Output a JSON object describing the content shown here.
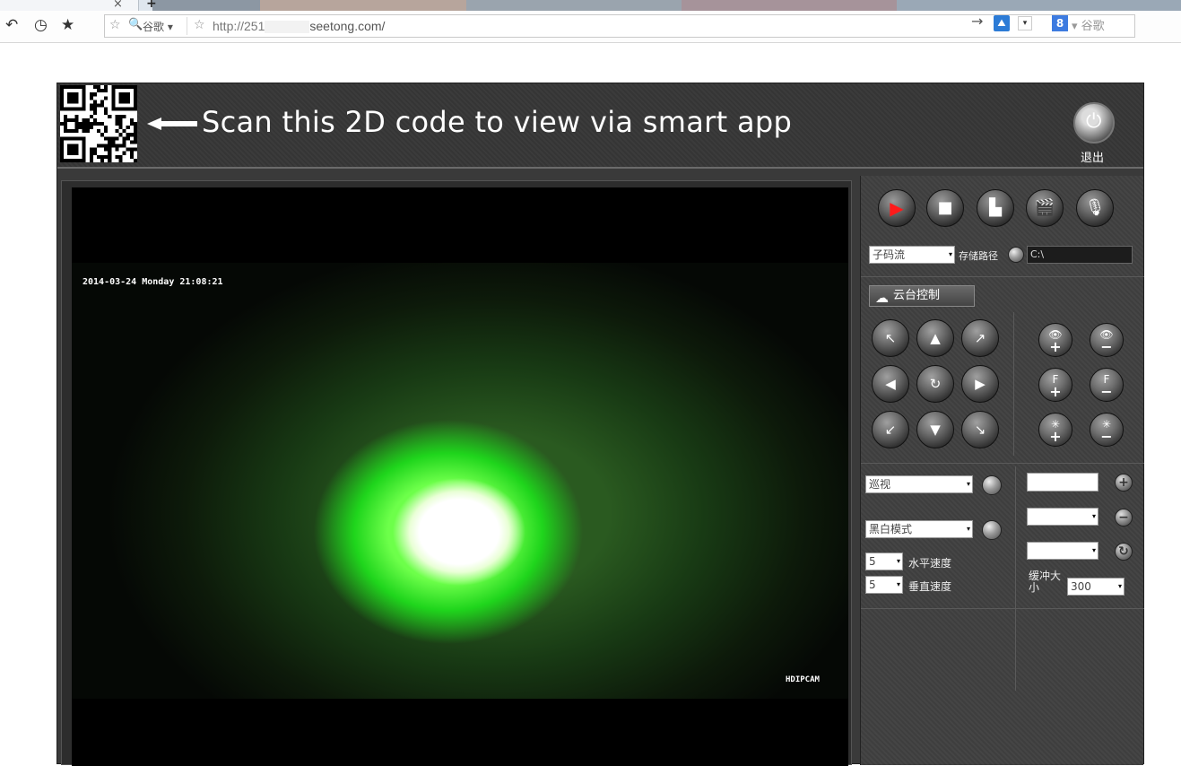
{
  "browser": {
    "tab_close": "×",
    "tab_new": "+",
    "nav_icons": [
      "undo-icon",
      "history-icon",
      "bookmark-icon"
    ],
    "search_engine": "谷歌",
    "url_prefix": "http://251",
    "url_suffix": "seetong.com/",
    "go_icon": "→",
    "google_label": "谷歌",
    "google_letter": "8",
    "search_dd": "▾"
  },
  "header": {
    "scan_text": "Scan this 2D code to view via smart app",
    "exit_label": "退出",
    "power_icon": "⏻"
  },
  "video": {
    "timestamp": "2014-03-24 Monday 21:08:21",
    "watermark": "HDIPCAM"
  },
  "controls": {
    "record_buttons": [
      {
        "name": "play",
        "glyph": "▶"
      },
      {
        "name": "stop",
        "glyph": "■"
      },
      {
        "name": "snapshot",
        "glyph": "▙"
      },
      {
        "name": "record",
        "glyph": "🎬"
      },
      {
        "name": "mic",
        "glyph": "🎙"
      }
    ],
    "stream_select": "子码流",
    "storage_label": "存储路径",
    "storage_path": "C:\\",
    "ptz_label": "云台控制",
    "ptz_buttons": [
      "↖",
      "▲",
      "↗",
      "◀",
      "↻",
      "▶",
      "↙",
      "▼",
      "↘"
    ],
    "zoom_buttons": [
      {
        "top": "👁",
        "bottom": "+"
      },
      {
        "top": "👁",
        "bottom": "−"
      },
      {
        "top": "F",
        "bottom": "+"
      },
      {
        "top": "F",
        "bottom": "−"
      },
      {
        "top": "✳",
        "bottom": "+"
      },
      {
        "top": "✳",
        "bottom": "−"
      }
    ],
    "cruise_select": "巡视",
    "bw_select": "黑白模式",
    "h_speed_value": "5",
    "h_speed_label": "水平速度",
    "v_speed_value": "5",
    "v_speed_label": "垂直速度",
    "buffer_label": "缓冲大小",
    "buffer_value": "300",
    "add_icon": "+",
    "remove_icon": "−",
    "refresh_icon": "↻",
    "dd": "▾"
  }
}
